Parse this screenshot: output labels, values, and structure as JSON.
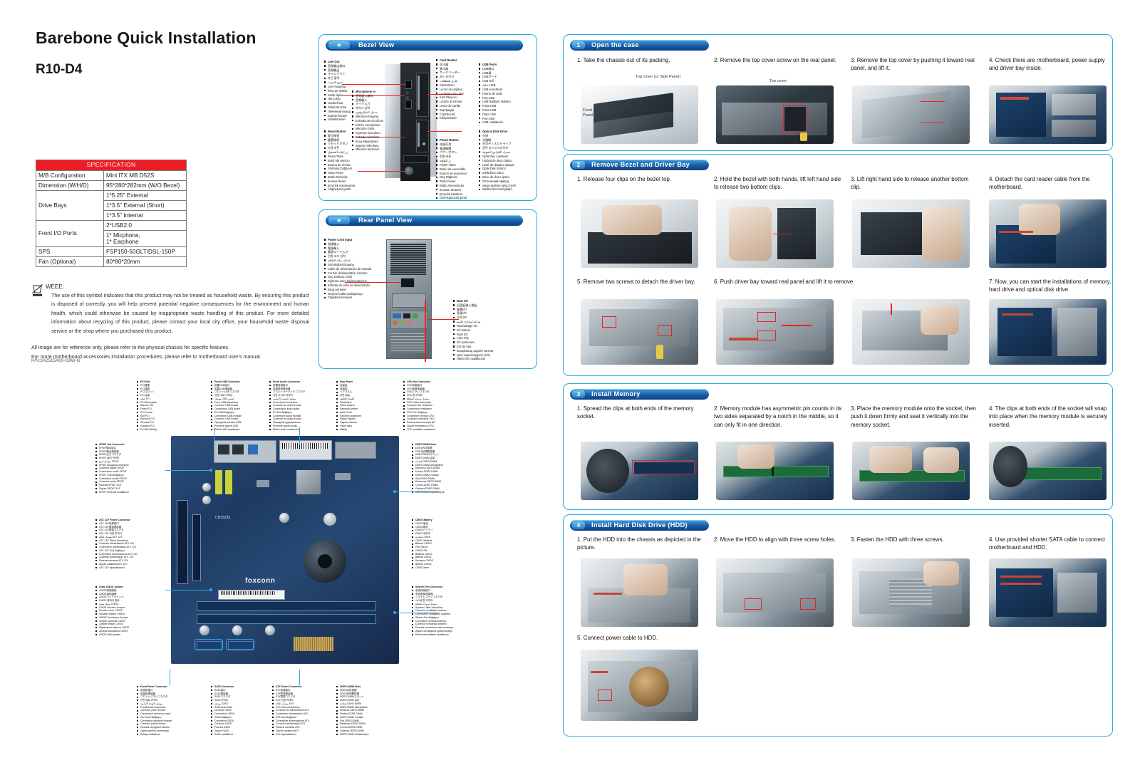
{
  "document": {
    "title": "Barebone Quick Installation",
    "model": "R10-D4",
    "part_number": "P/N:3A2515A00-G8W-G"
  },
  "specification": {
    "header": "SPECIFICATION",
    "rows": [
      {
        "key": "M/B Configuration",
        "values": [
          "Mini ITX MB D52S"
        ]
      },
      {
        "key": "Dimension (W/H/D)",
        "values": [
          "95*280*282mm (W/O Bezel)"
        ]
      },
      {
        "key": "Drive Bays",
        "values": [
          "1*5.25\" External",
          "1*3.5\" External (Short)",
          "1*3.5\" Internal"
        ]
      },
      {
        "key": "Front I/O Ports",
        "values": [
          "2*USB2.0",
          "1* Micphone,\n1* Earphone"
        ]
      },
      {
        "key": "SPS",
        "values": [
          "FSP150-50GLT/DSL-150P"
        ]
      },
      {
        "key": "Fan (Optional)",
        "values": [
          "80*80*20mm"
        ]
      }
    ]
  },
  "weee": {
    "heading": "WEEE:",
    "body": "The use of this symbol indicates that this product may not be treated as household waste. By ensuring this product is disposed of correctly, you will help prevent potential negative consequences for the environment and human health, which could otherwise be caused by inappropriate waste handling of this product. For more detailed information about recycling of this product, please contact your local city office, your household waste disposal service or the shop where you purchased this product.",
    "note_line1": "All image are for reference only, please refer to the physical chassis for specific features.",
    "note_line2": "For more motherboard accessories installation procedures, please refer to motherboard user's manual."
  },
  "bezel_view": {
    "title": "Bezel View",
    "badge": "star",
    "labels": {
      "line_out": [
        "Line Out",
        "音频输出端口",
        "音頻輸出",
        "ラインアウト",
        "라인 출력",
        "خرج الصوت",
        "Line-Ausgang",
        "linea de Salida",
        "Sortie ligne",
        "Hat Çıkışı",
        "Uscita linea",
        "Saída de linha",
        "Линейный выход",
        "wyjscie liniowe",
        "Vonalkimenet"
      ],
      "microphone_in": [
        "Microphone in",
        "音频输入端口",
        "音頻輸入",
        "マイク入力",
        "마이크 입력",
        "مدخل الميكروفون",
        "Mikrofon-Eingang",
        "Entrada de micrófono",
        "Entrée microphone",
        "Mikrofon Girişi",
        "Ingresso microfono",
        "Entrada microfone",
        "вход микрофона",
        "wejscie mikrofonu",
        "Mikrofon bemenet"
      ],
      "reset_button": [
        "Reset Button",
        "复位按钮",
        "重置按鈕",
        "リセットボタン",
        "리셋 버튼",
        "زر إعادة التشغيل",
        "Reset-Taste",
        "Botón de reinicio",
        "Bouton de remise",
        "Sıfırlama Düğmesi",
        "Tasto Reset",
        "Botão Reiniciar",
        "Кнопка Reset",
        "przycisk resetowania",
        "Alaphelyzet gomb"
      ],
      "card_reader": [
        "Card Reader",
        "读卡器",
        "讀卡器",
        "カードリーダー",
        "카드 리더기",
        "قارئ البطاقات",
        "Kartenleser",
        "Lector de tarjetas",
        "Le lecteur de carte",
        "Kart Okuyucu",
        "Lettore di schede",
        "Leitor de Cartão",
        "Картридер",
        "Czytnik kart",
        "Kártyaolvasó"
      ],
      "usb_ports": [
        "USB Ports",
        "USB端口",
        "USB埠",
        "USBポート",
        "USB 포트",
        "منافذ USB",
        "USB-Anschluss",
        "Puerto de USB",
        "Port USB",
        "USB Bağlantı Noktası",
        "Porta USB",
        "Porta USB",
        "Порт USB",
        "Port USB",
        "USB csatlakozó"
      ],
      "power_button": [
        "Power Button",
        "电源开关",
        "電源開關",
        "パワーボタン",
        "전원 버튼",
        "زر الطاقة",
        "Power-Taste",
        "Botón de encendido",
        "Bouton de puissance",
        "Güç Düğmesi",
        "Tasto Power",
        "Botão Alimentação",
        "Кнопка питания",
        "przycisk zasilania",
        "Üzemkapcsoló gomb"
      ],
      "optical_disk_drive": [
        "Optical Disk Drive",
        "光驱",
        "光碟機",
        "光学ディスクドライブ",
        "광학 디스크 드라이브",
        "محرك الأقراص الضوئية",
        "Optisches Laufwerk",
        "Unidad de disco óptico",
        "Unité de disques optique",
        "Optik Disk Sürücü",
        "unità disco ottico",
        "Drive do disco óptico",
        "Оптический привод",
        "stacja dysków optycznych",
        "Optikai lemezmeghajtó"
      ]
    }
  },
  "rear_panel_view": {
    "title": "Rear Panel View",
    "badge": "star",
    "labels": {
      "power_cord_input": [
        "Power Cord Input",
        "电源输入",
        "電源輸入",
        "電源コード入力",
        "전원 코드 입력",
        "إدخال سلك الطاقة",
        "Stromkabel Eingang",
        "Cable de alimentación de entrada",
        "Cordon d'alimentation d'entrée",
        "Güç Kablosu Girişi",
        "Ingresso cavo d'alimentazione",
        "Entrada de cabo de alimentação",
        "Вход питания",
        "Wejscie kabla zasilajacego",
        "Tápkábel bemenet"
      ],
      "rear_io": [
        "Rear I/O",
        "后面板输入输出",
        "後置I/O",
        "背面I/O",
        "후면 I/O",
        "مداخل/مخارج خلفية",
        "Rückwärtige I/O",
        "I/O trasero",
        "Rear I/O",
        "Arka G/Ç",
        "I/O posteriore",
        "E/S de trás",
        "Вход/выход задней панели",
        "tylne wejscie/wyjscie (I/O)",
        "Hátsó I/O csatlakozók"
      ]
    }
  },
  "motherboard_diagram": {
    "brand": "foxconn",
    "board_marking": "CN15235",
    "connector_labels": [
      {
        "name": "PCI Slot",
        "langs": [
          "PCI插槽",
          "PCI插槽",
          "PCIスロット",
          "PCI 슬롯",
          "فتحة PCI",
          "PCI-Steckplatz",
          "Ranura PCI",
          "Fente PCI",
          "PCI Yuvası",
          "Slot PCI",
          "Ranhura PCI",
          "Разъем PCI",
          "Gniazdo PCI",
          "PCI Bővítőhely"
        ]
      },
      {
        "name": "Front USB Connector",
        "langs": [
          "前置USB接口",
          "前置USB連接器",
          "フロントUSBコネクタ",
          "전면 USB 커넥터",
          "موصل USB أمامي",
          "Front USB Anschluss",
          "Conector USB frontal",
          "Connecteur USB avant",
          "Ön USB Bağlayıcı",
          "Connettore USB frontale",
          "Conector USB frontal",
          "Передний разъем USB",
          "Przednie złącze USB",
          "Elülső USB csatlakozó"
        ]
      },
      {
        "name": "Front Audio Connector",
        "langs": [
          "前置音频接口",
          "前置音頻連接器",
          "フロントオーディオコネクタ",
          "전면 오디오 커넥터",
          "موصل الصوت الأمامي",
          "Front Audio Anschluss",
          "Conector de audio frontal",
          "Connecteur audio avant",
          "Ön Ses Bağlayıcı",
          "Connettore audio frontale",
          "Conector de áudio frontal",
          "Передний аудиоразъем",
          "Przednie złącze audio",
          "Elülső audio csatlakozó"
        ]
      },
      {
        "name": "Rear Panel",
        "langs": [
          "后面板",
          "後面板",
          "リアパネル",
          "후면 패널",
          "اللوحة الخلفية",
          "Rückwand",
          "Panel trasero",
          "Panneau arrière",
          "Arka Panel",
          "Pannello posteriore",
          "Painel traseiro",
          "Задняя панель",
          "Panel tylny",
          "Hátlap"
        ]
      },
      {
        "name": "CPU Fan Connector",
        "langs": [
          "CPU风扇接口",
          "CPU風扇連接器",
          "CPUファンコネクタ",
          "CPU 팬 커넥터",
          "موصل مروحة المعالج",
          "CPU Lüfter Anschluss",
          "Conector del ventilador",
          "Connecteur ventilateur",
          "CPU Fan Bağlayıcı",
          "Connettore ventola CPU",
          "Conector ventoinha CPU",
          "Разъем вентилятора ЦП",
          "Złącze wentylatora CPU",
          "CPU ventilátor csatlakozó"
        ]
      },
      {
        "name": "SPDIF Out Connector",
        "langs": [
          "SPDIF输出接口",
          "SPDIF輸出連接器",
          "SPDIF出力コネクタ",
          "SPDIF 출력 커넥터",
          "موصل خرج SPDIF",
          "SPDIF Ausgang Anschluss",
          "Conector salida SPDIF",
          "Connecteur sortie SPDIF",
          "SPDIF Çıkış Bağlayıcı",
          "Connettore uscita SPDIF",
          "Conector saída SPDIF",
          "Разъем SPDIF OUT",
          "Złącze SPDIF OUT",
          "SPDIF kimeneti csatlakozó"
        ]
      },
      {
        "name": "Clear CMOS Jumper",
        "langs": [
          "CMOS清除跳线",
          "CMOS清除跳線",
          "CMOSクリアジャンパ",
          "CMOS 클리어 점퍼",
          "وصلة مسح CMOS",
          "CMOS löschen Jumper",
          "Puente borrar CMOS",
          "Cavalier effacer CMOS",
          "CMOS Temizleme Jumper",
          "Jumper cancella CMOS",
          "Jumper limpar CMOS",
          "Перемычка сброса CMOS",
          "Zworka kasowania CMOS",
          "CMOS törlő jumper"
        ]
      },
      {
        "name": "SATA Connector",
        "langs": [
          "SATA接口",
          "SATA連接器",
          "SATAコネクタ",
          "SATA 커넥터",
          "موصل SATA",
          "SATA Anschluss",
          "Conector SATA",
          "Connecteur SATA",
          "SATA Bağlayıcı",
          "Connettore SATA",
          "Conector SATA",
          "Разъем SATA",
          "Złącze SATA",
          "SATA csatlakozó"
        ]
      },
      {
        "name": "Front Panel Connector",
        "langs": [
          "前面板接口",
          "前面板連接器",
          "フロントパネルコネクタ",
          "전면 패널 커넥터",
          "موصل اللوحة الأمامية",
          "Frontblende Anschluss",
          "Conector panel frontal",
          "Connecteur panneau avant",
          "Ön Panel Bağlayıcı",
          "Connettore pannello frontale",
          "Conector painel frontal",
          "Разъем передней панели",
          "Złącze panelu przedniego",
          "Előlapi csatlakozó"
        ]
      },
      {
        "name": "ATX Power Connector",
        "langs": [
          "ATX电源接口",
          "ATX電源連接器",
          "ATX電源コネクタ",
          "ATX 전원 커넥터",
          "موصل طاقة ATX",
          "ATX Strom Anschluss",
          "Conector de alimentación ATX",
          "Connecteur alimentation ATX",
          "ATX Güç Bağlayıcı",
          "Connettore alimentazione ATX",
          "Conector alimentação ATX",
          "Разъем питания ATX",
          "Złącze zasilania ATX",
          "ATX tápcsatlakozó"
        ]
      },
      {
        "name": "DDR3 DIMM Slots",
        "langs": [
          "DDR3内存插槽",
          "DDR3記憶體插槽",
          "DDR3 DIMMスロット",
          "DDR3 DIMM 슬롯",
          "فتحات DDR3 DIMM",
          "DDR3 DIMM Steckplätze",
          "Ranuras DDR3 DIMM",
          "Fentes DDR3 DIMM",
          "DDR3 DIMM Yuvaları",
          "Slot DDR3 DIMM",
          "Ranhuras DDR3 DIMM",
          "Слоты DDR3 DIMM",
          "Gniazda DDR3 DIMM",
          "DDR3 DIMM bővítőhelyek"
        ]
      },
      {
        "name": "ATX 12V Power Connector",
        "langs": [
          "ATX 12V电源接口",
          "ATX 12V電源連接器",
          "ATX 12V電源コネクタ",
          "ATX 12V 전원 커넥터",
          "موصل طاقة ATX 12V",
          "ATX 12V Strom Anschluss",
          "Conector alimentación ATX 12V",
          "Connecteur alimentation ATX 12V",
          "ATX 12V Güç Bağlayıcı",
          "Connettore alimentazione ATX 12V",
          "Conector alimentação ATX 12V",
          "Разъем питания ATX 12V",
          "Złącze zasilania ATX 12V",
          "ATX 12V tápcsatlakozó"
        ]
      },
      {
        "name": "System Fan Connector",
        "langs": [
          "系统风扇接口",
          "系統風扇連接器",
          "システムファンコネクタ",
          "시스템 팬 커넥터",
          "موصل مروحة النظام",
          "System Lüfter Anschluss",
          "Conector ventilador sistema",
          "Connecteur ventilateur système",
          "Sistem Fan Bağlayıcı",
          "Connettore ventola sistema",
          "Conector ventoinha sistema",
          "Разъем системного вентилятора",
          "Złącze wentylatora systemowego",
          "Rendszerventilátor csatlakozó"
        ]
      },
      {
        "name": "CMOS Battery",
        "langs": [
          "CMOS电池",
          "CMOS電池",
          "CMOSバッテリ",
          "CMOS 배터리",
          "بطارية CMOS",
          "CMOS Batterie",
          "Batería CMOS",
          "Pile CMOS",
          "CMOS Pili",
          "Batteria CMOS",
          "Bateria CMOS",
          "Батарея CMOS",
          "Bateria CMOS",
          "CMOS elem"
        ]
      }
    ]
  },
  "sections": [
    {
      "number": "1",
      "title": "Open the case",
      "steps": [
        {
          "n": "1.",
          "text": "Take the chassis out of its packing.",
          "annotations": [
            "Top cover (or Side Panel)",
            "Front Panel"
          ]
        },
        {
          "n": "2.",
          "text": "Remove the top cover screw on the real panel.",
          "annotations": [
            "Top cover"
          ]
        },
        {
          "n": "3.",
          "text": "Remove the top cover by pushing it toward real panel, and lift it.",
          "annotations": []
        },
        {
          "n": "4.",
          "text": "Check there are motherboard, power supply and driver bay inside.",
          "annotations": []
        }
      ]
    },
    {
      "number": "2",
      "title": "Remove Bezel and Driver Bay",
      "steps": [
        {
          "n": "1.",
          "text": "Release four clips on the bezel top.",
          "annotations": []
        },
        {
          "n": "2.",
          "text": "Hold the bezel with both hands, lift left hand side to release two bottom clips.",
          "annotations": []
        },
        {
          "n": "3.",
          "text": "Lift right hand side to release another bottom clip.",
          "annotations": []
        },
        {
          "n": "4.",
          "text": "Detach the card reader cable from the motherboard.",
          "annotations": []
        },
        {
          "n": "5.",
          "text": "Remove two screws to detach the driver bay.",
          "annotations": []
        },
        {
          "n": "6.",
          "text": "Push driver bay toward real panel and lift it to remove.",
          "annotations": []
        },
        {
          "n": "7.",
          "text": "Now, you can start the installations of memory, hard drive and optical disk drive.",
          "annotations": []
        }
      ]
    },
    {
      "number": "3",
      "title": "Install Memory",
      "steps": [
        {
          "n": "1.",
          "text": "Spread the clips at both ends of the memory socket.",
          "annotations": []
        },
        {
          "n": "2.",
          "text": "Memory module has asymmetric pin counts in its two sides separated by a notch in the middle, so it can only fit in one direction.",
          "annotations": []
        },
        {
          "n": "3.",
          "text": "Place the memory module onto the socket, then push it down firmly and seat it vertically into the memory socket.",
          "annotations": []
        },
        {
          "n": "4.",
          "text": "The clips at both ends of the socket will snap into place when the memory module is securely inserted.",
          "annotations": []
        }
      ]
    },
    {
      "number": "4",
      "title": "Install Hard Disk Drive (HDD)",
      "steps": [
        {
          "n": "1.",
          "text": "Put the HDD into the chassis as depicted in the picture.",
          "annotations": []
        },
        {
          "n": "2.",
          "text": "Move the HDD to align with three screw holes.",
          "annotations": []
        },
        {
          "n": "3.",
          "text": "Fasten the HDD with three screws.",
          "annotations": []
        },
        {
          "n": "4.",
          "text": "Use provided shorter SATA cable to connect motherboard and HDD.",
          "annotations": []
        },
        {
          "n": "5.",
          "text": "Connect power cable to HDD.",
          "annotations": []
        }
      ]
    }
  ],
  "colors": {
    "accent_blue": "#29abe2",
    "header_blue_dark": "#0d3f7e",
    "spec_header_red": "#ed1c24",
    "highlight_red": "#e8231f"
  }
}
